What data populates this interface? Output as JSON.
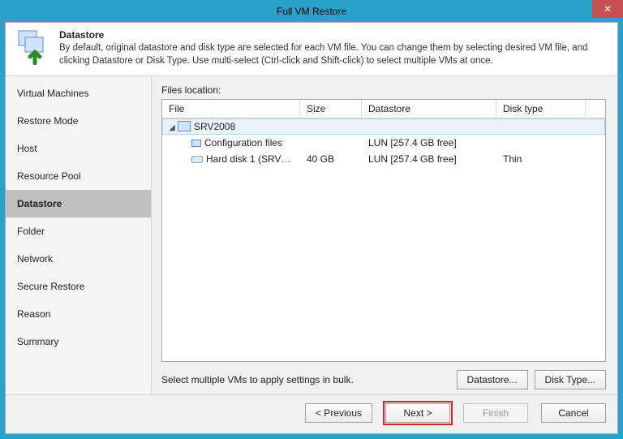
{
  "window": {
    "title": "Full VM Restore"
  },
  "header": {
    "heading": "Datastore",
    "desc": "By default, original datastore and disk type are selected for each VM file. You can change them by selecting desired VM file, and clicking Datastore or Disk Type. Use multi-select (Ctrl-click and Shift-click) to select multiple VMs at once."
  },
  "sidebar": {
    "items": [
      {
        "label": "Virtual Machines",
        "selected": false
      },
      {
        "label": "Restore Mode",
        "selected": false
      },
      {
        "label": "Host",
        "selected": false
      },
      {
        "label": "Resource Pool",
        "selected": false
      },
      {
        "label": "Datastore",
        "selected": true
      },
      {
        "label": "Folder",
        "selected": false
      },
      {
        "label": "Network",
        "selected": false
      },
      {
        "label": "Secure Restore",
        "selected": false
      },
      {
        "label": "Reason",
        "selected": false
      },
      {
        "label": "Summary",
        "selected": false
      }
    ]
  },
  "files": {
    "label": "Files location:",
    "columns": {
      "file": "File",
      "size": "Size",
      "datastore": "Datastore",
      "disktype": "Disk type"
    },
    "tree": {
      "vm": {
        "name": "SRV2008",
        "expanded": true
      },
      "children": [
        {
          "file": "Configuration files",
          "size": "",
          "datastore": "LUN [257.4 GB free]",
          "disktype": "",
          "icon": "conf"
        },
        {
          "file": "Hard disk 1 (SRV200...",
          "size": "40 GB",
          "datastore": "LUN [257.4 GB free]",
          "disktype": "Thin",
          "icon": "disk"
        }
      ]
    },
    "bulk_hint": "Select multiple VMs to apply settings in bulk.",
    "btn_datastore": "Datastore...",
    "btn_disktype": "Disk Type..."
  },
  "footer": {
    "previous": "< Previous",
    "next": "Next >",
    "finish": "Finish",
    "cancel": "Cancel"
  }
}
